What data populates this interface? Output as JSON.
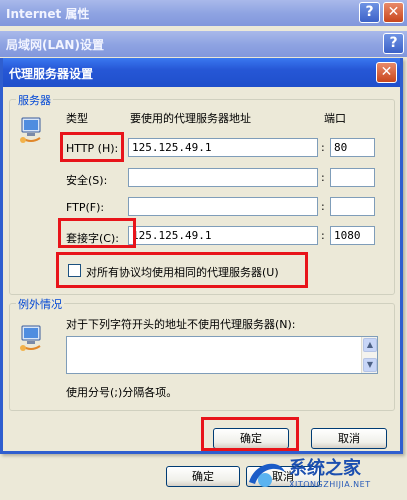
{
  "internet_window": {
    "title": "Internet 属性",
    "buttons": {
      "help": "?",
      "close": "✕"
    },
    "ok": "确定",
    "cancel": "取消"
  },
  "lan_window": {
    "title": "局域网(LAN)设置",
    "help": "?"
  },
  "proxy": {
    "title": "代理服务器设置",
    "close": "✕",
    "servers": {
      "legend": "服务器",
      "col_type": "类型",
      "col_address": "要使用的代理服务器地址",
      "col_port": "端口",
      "rows": [
        {
          "label": "HTTP (H):",
          "address": "125.125.49.1",
          "port": "80"
        },
        {
          "label": "安全(S):",
          "address": "",
          "port": ""
        },
        {
          "label": "FTP(F):",
          "address": "",
          "port": ""
        },
        {
          "label": "套接字(C):",
          "address": "125.125.49.1",
          "port": "1080"
        }
      ],
      "colon": ":",
      "same_proxy_label": "对所有协议均使用相同的代理服务器(U)",
      "same_proxy_checked": false
    },
    "exceptions": {
      "legend": "例外情况",
      "description": "对于下列字符开头的地址不使用代理服务器(N):",
      "value": "",
      "hint": "使用分号(;)分隔各项。"
    },
    "ok": "确定",
    "cancel": "取消"
  },
  "watermark": {
    "text": "系统之家",
    "url": "XITONGZHIJIA.NET"
  },
  "colors": {
    "highlight": "#e8141a",
    "legend": "#0046d5",
    "title_active": "#2657d6"
  }
}
